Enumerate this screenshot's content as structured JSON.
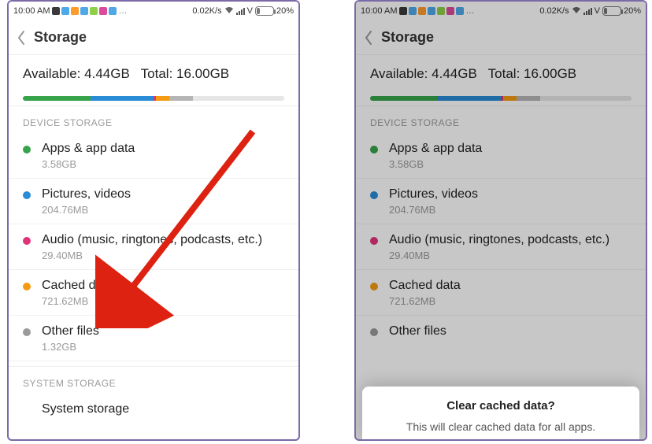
{
  "status": {
    "time": "10:00 AM",
    "net_speed": "0.02K/s",
    "carrier": "V",
    "battery_pct": "20%",
    "icon_colors": [
      "#3a3a3a",
      "#4fa8e8",
      "#ff9b2b",
      "#4fa8e8",
      "#8fcf4a",
      "#db4b9b",
      "#4fa8e8"
    ]
  },
  "header": {
    "title": "Storage"
  },
  "summary": {
    "available_label": "Available:",
    "available_value": "4.44GB",
    "total_label": "Total:",
    "total_value": "16.00GB"
  },
  "bar_segments": [
    {
      "color": "#37a34a",
      "pct": 26
    },
    {
      "color": "#2a8bd6",
      "pct": 24
    },
    {
      "color": "#e0347a",
      "pct": 1
    },
    {
      "color": "#f39c12",
      "pct": 5
    },
    {
      "color": "#b5b5b5",
      "pct": 9
    },
    {
      "color": "#e6e6e6",
      "pct": 35
    }
  ],
  "sections": {
    "device": {
      "title": "DEVICE STORAGE",
      "items": [
        {
          "dot": "#37a34a",
          "label": "Apps & app data",
          "sub": "3.58GB"
        },
        {
          "dot": "#2a8bd6",
          "label": "Pictures, videos",
          "sub": "204.76MB"
        },
        {
          "dot": "#e0347a",
          "label": "Audio (music, ringtones, podcasts, etc.)",
          "sub": "29.40MB"
        },
        {
          "dot": "#f39c12",
          "label": "Cached data",
          "sub": "721.62MB"
        },
        {
          "dot": "#9a9a9a",
          "label": "Other files",
          "sub": "1.32GB"
        }
      ]
    },
    "system": {
      "title": "SYSTEM STORAGE",
      "items": [
        {
          "dot": "#9a9a9a",
          "label": "System storage",
          "sub": ""
        }
      ]
    }
  },
  "dialog": {
    "title": "Clear cached data?",
    "message": "This will clear cached data for all apps."
  }
}
